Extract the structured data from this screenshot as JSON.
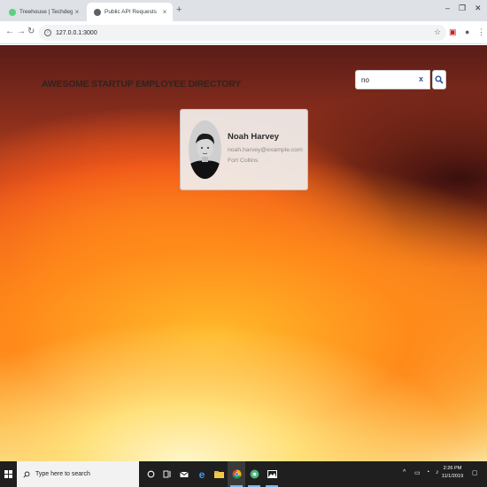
{
  "browser": {
    "tabs": [
      {
        "title": "Treehouse | Techdegree",
        "close": "×",
        "active": false,
        "favicon": "treehouse-icon"
      },
      {
        "title": "Public API Requests",
        "close": "×",
        "active": true,
        "favicon": "globe-icon"
      }
    ],
    "new_tab": "+",
    "url": "127.0.0.1:3000"
  },
  "page": {
    "title": "Awesome Startup Employee Directory",
    "search": {
      "value": "no",
      "clear": "x"
    }
  },
  "employees": [
    {
      "name": "Noah Harvey",
      "email": "noah.harvey@example.com",
      "city": "Fort Collins"
    }
  ],
  "taskbar": {
    "search_placeholder": "Type here to search",
    "time": "2:26 PM",
    "date": "11/1/2019"
  },
  "colors": {
    "accent": "#2b4f9e",
    "taskbar": "#1f1f1f",
    "chrome_tabstrip": "#dee1e6"
  }
}
